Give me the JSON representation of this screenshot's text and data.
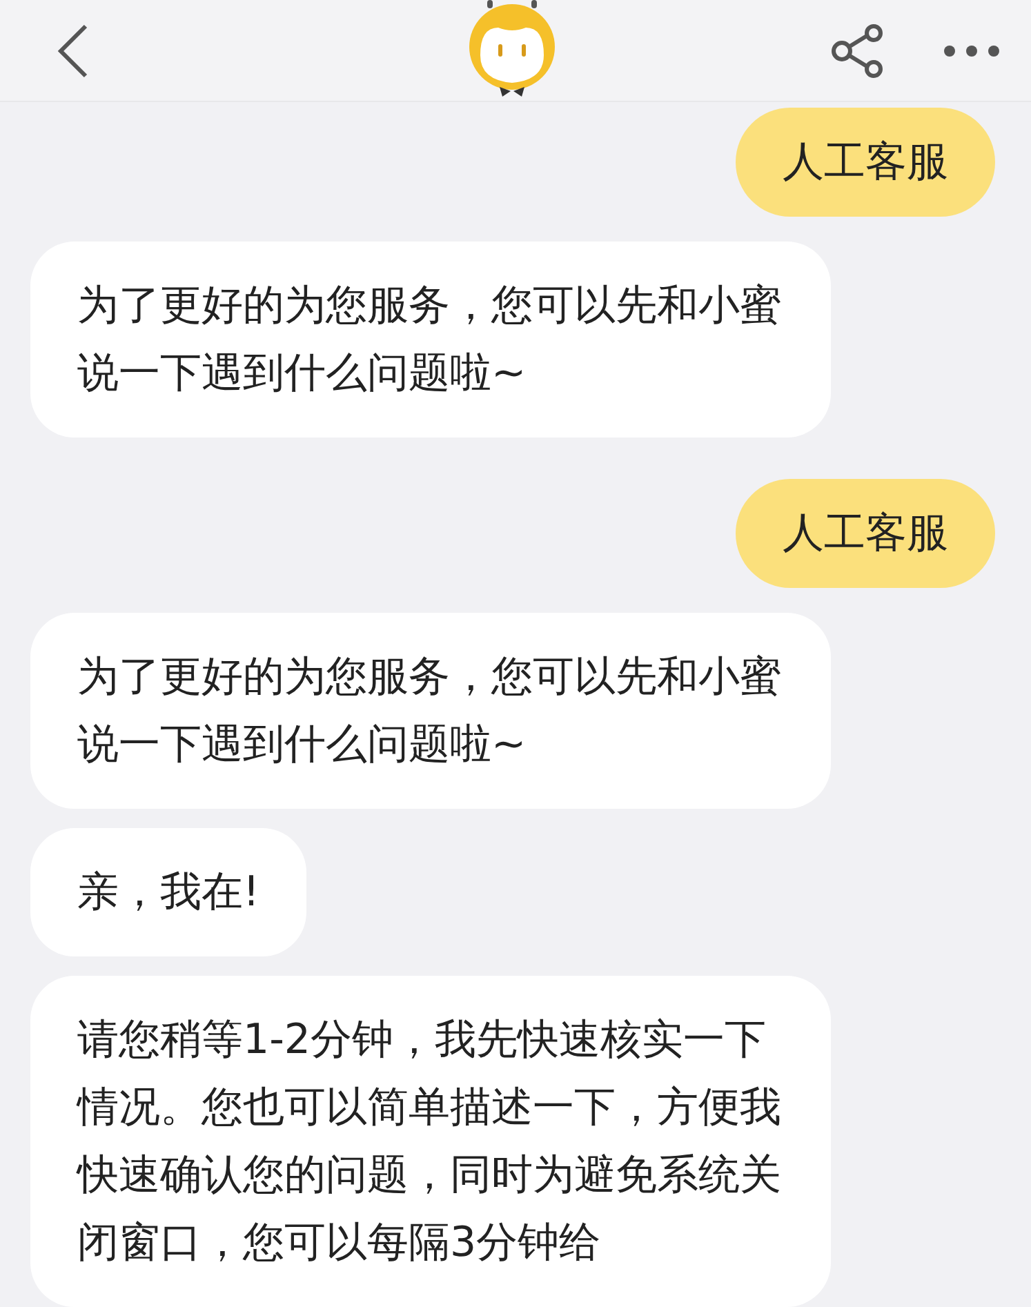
{
  "messages": [
    {
      "kind": "user",
      "text": "人工客服"
    },
    {
      "kind": "bot",
      "text": "为了更好的为您服务，您可以先和小蜜说一下遇到什么问题啦~"
    },
    {
      "kind": "user",
      "text": "人工客服"
    },
    {
      "kind": "bot",
      "text": "为了更好的为您服务，您可以先和小蜜说一下遇到什么问题啦~"
    },
    {
      "kind": "bot",
      "text": "亲，我在!"
    },
    {
      "kind": "bot",
      "text": "请您稍等1-2分钟，我先快速核实一下情况。您也可以简单描述一下，方便我快速确认您的问题，同时为避免系统关闭窗口，您可以每隔3分钟给"
    }
  ]
}
